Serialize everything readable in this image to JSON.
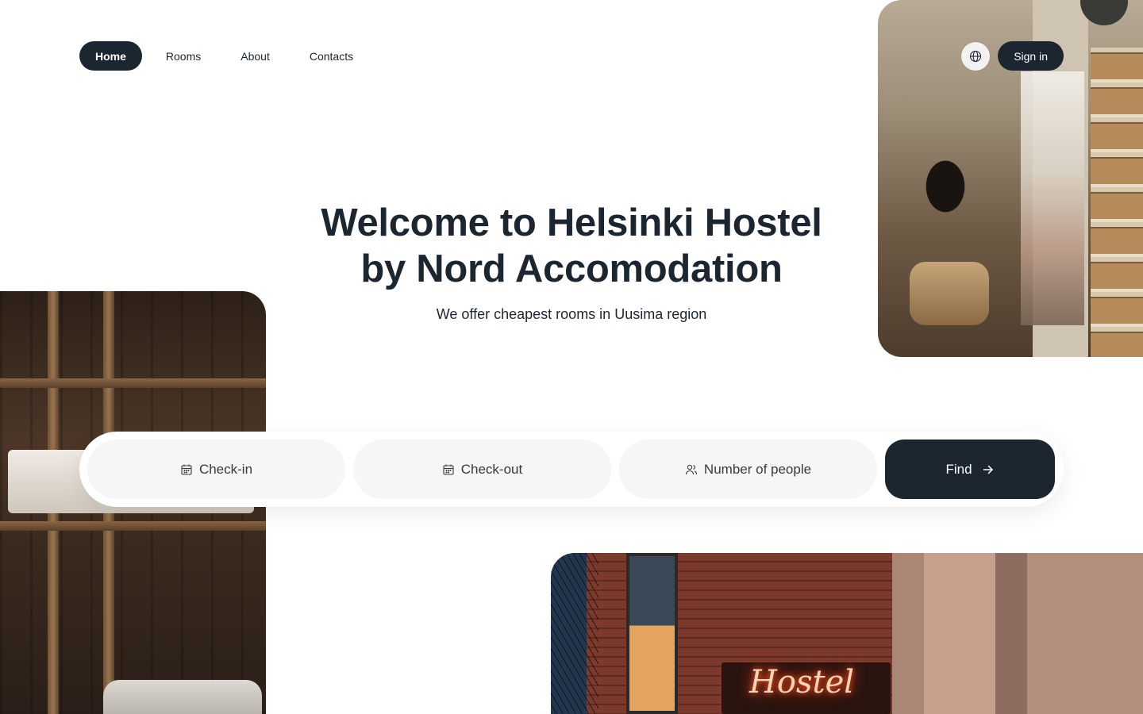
{
  "nav": {
    "items": [
      {
        "label": "Home",
        "active": true
      },
      {
        "label": "Rooms",
        "active": false
      },
      {
        "label": "About",
        "active": false
      },
      {
        "label": "Contacts",
        "active": false
      }
    ]
  },
  "header_actions": {
    "language_icon": "globe-icon",
    "sign_in_label": "Sign in"
  },
  "hero": {
    "title": "Welcome to Helsinki Hostel by Nord Accomodation",
    "subtitle": "We offer cheapest rooms in Uusima region"
  },
  "search": {
    "check_in_label": "Check-in",
    "check_in_icon": "calendar-icon",
    "check_out_label": "Check-out",
    "check_out_icon": "calendar-icon",
    "people_label": "Number of people",
    "people_icon": "users-icon",
    "find_label": "Find",
    "find_icon": "arrow-right-icon"
  },
  "photos": {
    "street_sign_text": "Hostel"
  },
  "colors": {
    "primary_dark": "#1c2630",
    "field_background": "#f6f6f6",
    "page_background": "#ffffff"
  }
}
